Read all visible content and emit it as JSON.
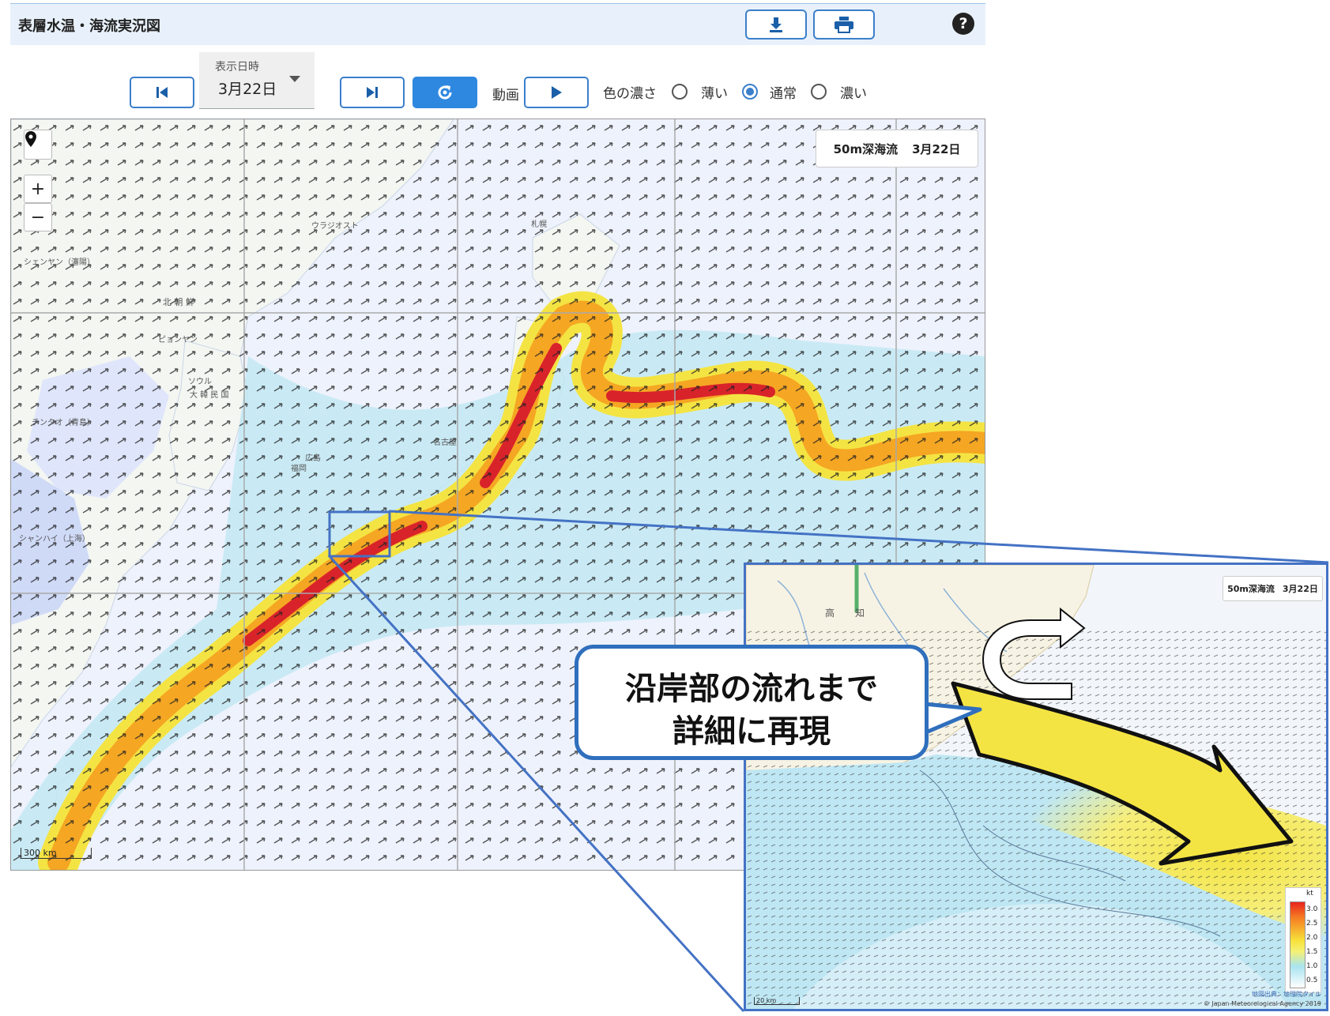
{
  "header": {
    "title": "表層水温・海流実況図",
    "download_icon": "download-icon",
    "print_icon": "print-icon",
    "help_label": "?"
  },
  "toolbar": {
    "date_caption": "表示日時",
    "date_value": "3月22日",
    "animation_label": "動画",
    "color_depth_label": "色の濃さ",
    "color_options": [
      {
        "label": "薄い",
        "selected": false
      },
      {
        "label": "通常",
        "selected": true
      },
      {
        "label": "濃い",
        "selected": false
      }
    ],
    "accent_color": "#3b7fcb"
  },
  "map": {
    "layer_name": "50m深海流",
    "layer_date": "3月22日",
    "zoom_in": "+",
    "zoom_out": "−",
    "scale": "300 km",
    "place_labels": [
      "ウラジオスト",
      "シェンヤン（瀋陽）",
      "北 朝 鮮",
      "ピョンヤン",
      "ソウル",
      "大 韓 民 国",
      "チンタオ（青島）",
      "シャンハイ（上海）",
      "札幌",
      "名古屋",
      "福岡",
      "広島"
    ]
  },
  "inset": {
    "layer_name": "50m深海流",
    "layer_date": "3月22日",
    "place_labels": [
      "高",
      "知"
    ],
    "scale": "20 km",
    "credit_source": "地図出典：地理院タイル",
    "credit_copyright": "© Japan Meteorological Agency 2019",
    "legend": {
      "unit": "kt",
      "ticks": [
        "3.0",
        "2.5",
        "2.0",
        "1.5",
        "1.0",
        "0.5"
      ],
      "colors": [
        "#e8231e",
        "#f57d22",
        "#f7e23b",
        "#a9e4ef",
        "#ffffff"
      ]
    }
  },
  "callout": {
    "line1": "沿岸部の流れまで",
    "line2": "詳細に再現"
  },
  "colors": {
    "sea": "#eef2fc",
    "land": "#f4f6f2",
    "current_strong": "#d9232a",
    "current_mid": "#f5a623",
    "current_weak": "#f4e443",
    "current_slow": "#9fdcee",
    "highlight_border": "#4472c4"
  }
}
